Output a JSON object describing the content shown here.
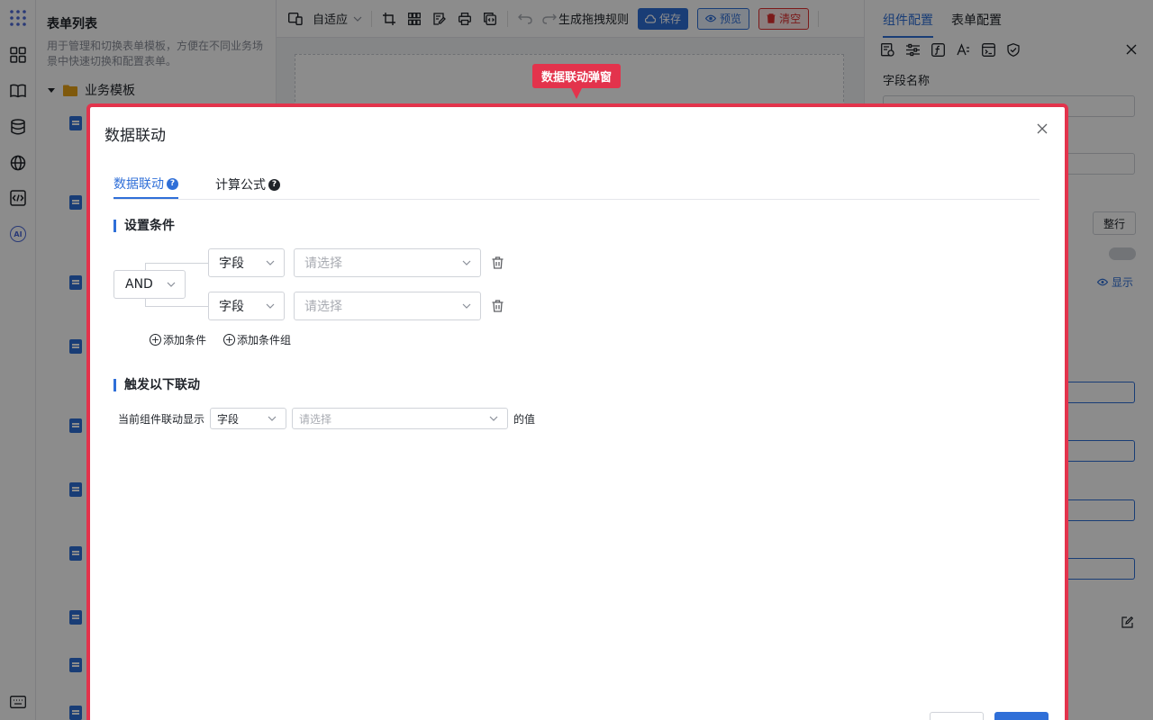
{
  "list_panel": {
    "title": "表单列表",
    "description": "用于管理和切换表单模板，方便在不同业务场景中快速切换和配置表单。",
    "root_folder": "业务模板"
  },
  "toolbar": {
    "layout_mode": "自适应",
    "generate_rules": "生成拖拽规则",
    "save": "保存",
    "preview": "预览",
    "clear": "清空"
  },
  "right_panel": {
    "tab_component": "组件配置",
    "tab_form": "表单配置",
    "field_name_label": "字段名称",
    "show_label": "显示",
    "row_label": "整行"
  },
  "callout": {
    "label": "数据联动弹窗"
  },
  "modal": {
    "title": "数据联动",
    "tabs": [
      {
        "label": "数据联动",
        "help": "?"
      },
      {
        "label": "计算公式",
        "help": "?"
      }
    ],
    "conditions": {
      "section_title": "设置条件",
      "logic": "AND",
      "rows": [
        {
          "field": "字段",
          "value_placeholder": "请选择"
        },
        {
          "field": "字段",
          "value_placeholder": "请选择"
        }
      ],
      "add_condition": "添加条件",
      "add_condition_group": "添加条件组"
    },
    "trigger": {
      "section_title": "触发以下联动",
      "prefix": "当前组件联动显示",
      "field": "字段",
      "value_placeholder": "请选择",
      "suffix": "的值"
    }
  },
  "colors": {
    "accent": "#2f6fd8",
    "callout_red": "#e3334c",
    "danger": "#e03131"
  }
}
